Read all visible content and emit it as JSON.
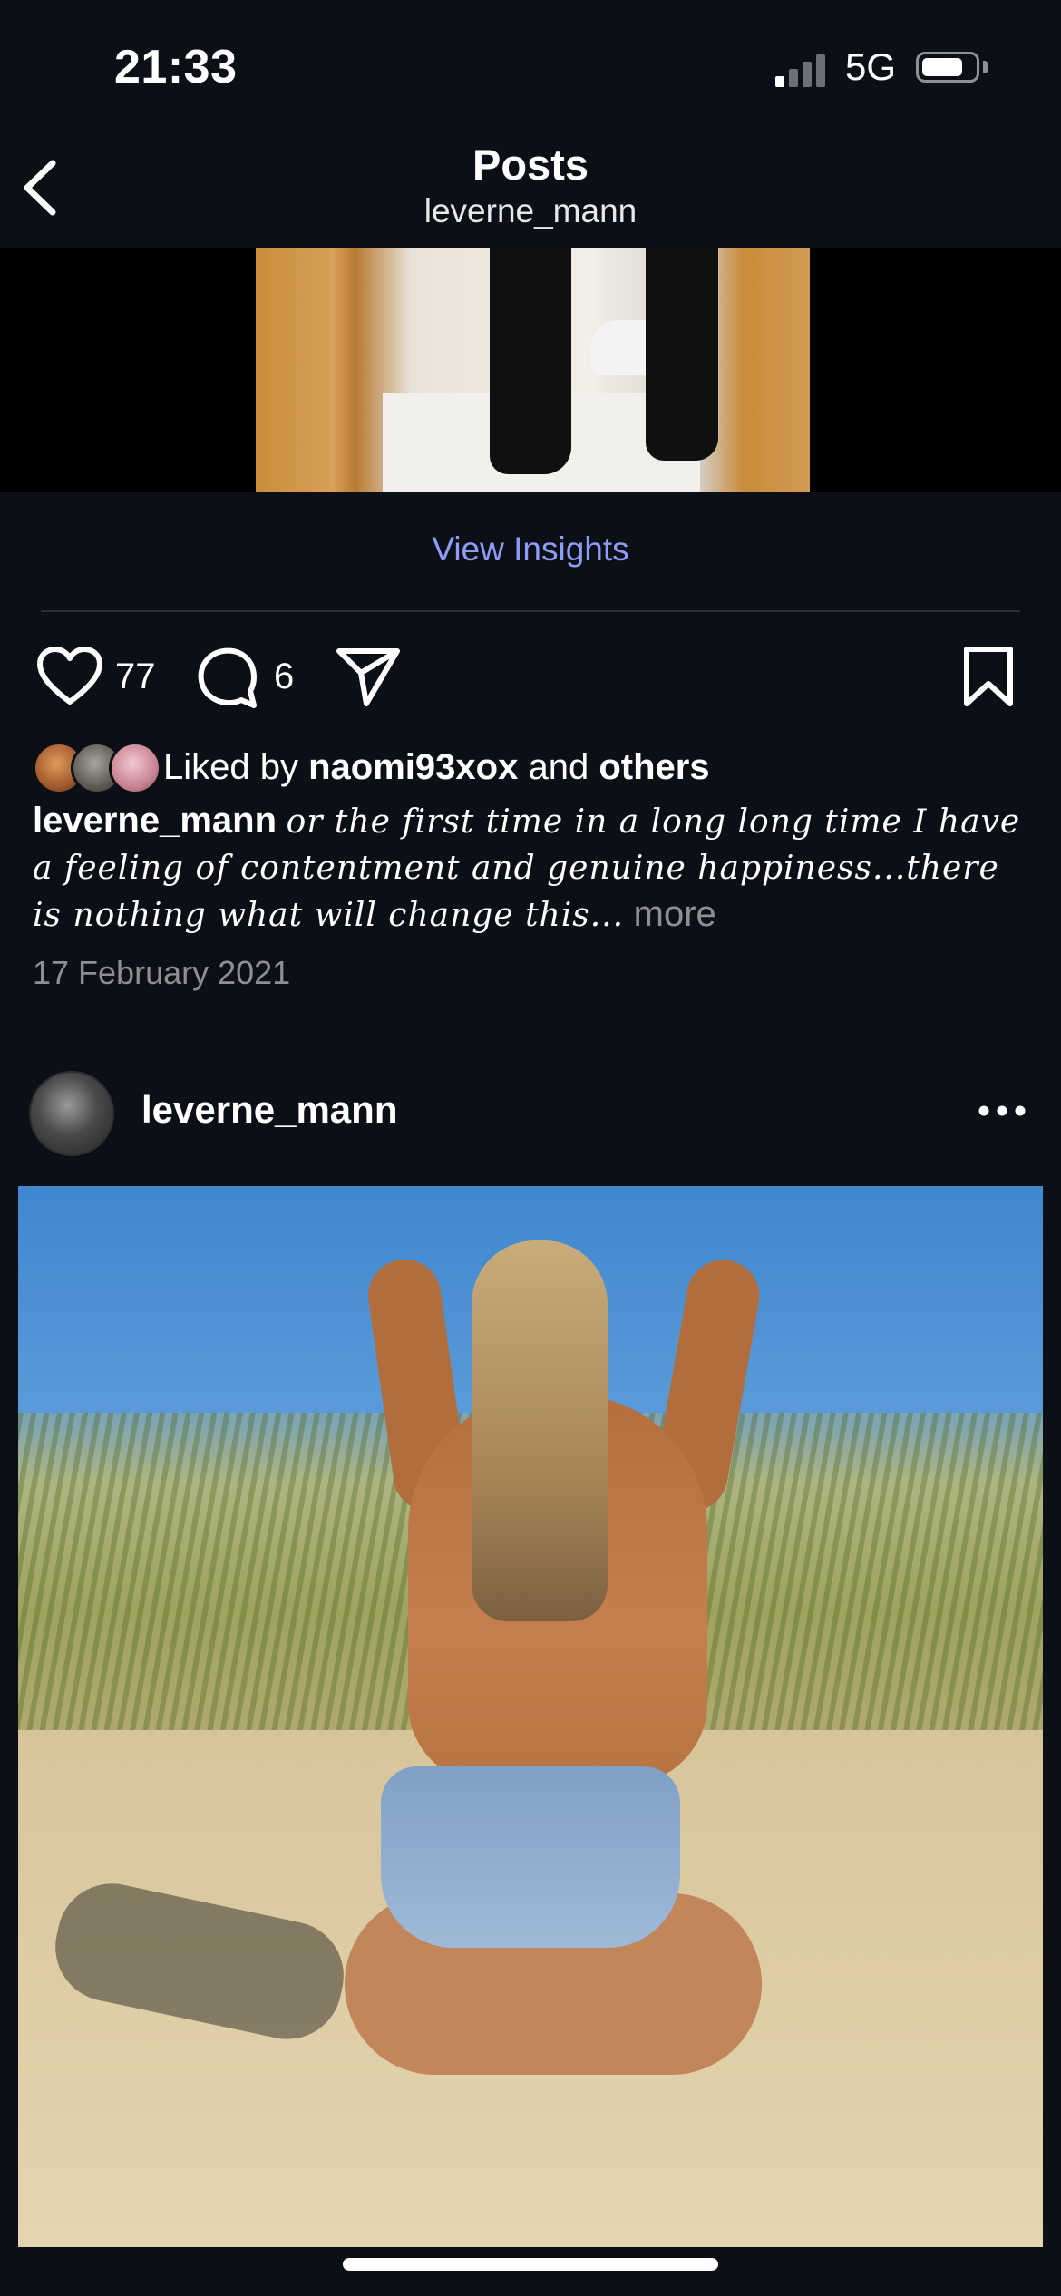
{
  "status_bar": {
    "time": "21:33",
    "network": "5G",
    "signal_bars_active": 1,
    "signal_bars_total": 4
  },
  "header": {
    "title": "Posts",
    "subtitle": "leverne_mann"
  },
  "first_post": {
    "insights_label": "View Insights",
    "like_count": "77",
    "comment_count": "6",
    "liked_by_prefix": "Liked by",
    "liked_by_user": "naomi93xox",
    "liked_by_joiner": "and",
    "liked_by_others": "others",
    "caption_username": "leverne_mann",
    "caption_text": "or the first time in a long long time I have a feeling of contentment and genuine happiness...there is nothing what will change this...",
    "caption_more": "more",
    "date": "17 February 2021"
  },
  "second_post": {
    "username": "leverne_mann"
  },
  "colors": {
    "background": "#0c0f16",
    "accent_link": "#8f9cf7",
    "muted_text": "#8e8f95"
  },
  "icons": {
    "back": "chevron-left-icon",
    "like": "heart-icon",
    "comment": "comment-bubble-icon",
    "share": "paper-plane-icon",
    "save": "bookmark-icon",
    "options": "more-dots-icon"
  }
}
